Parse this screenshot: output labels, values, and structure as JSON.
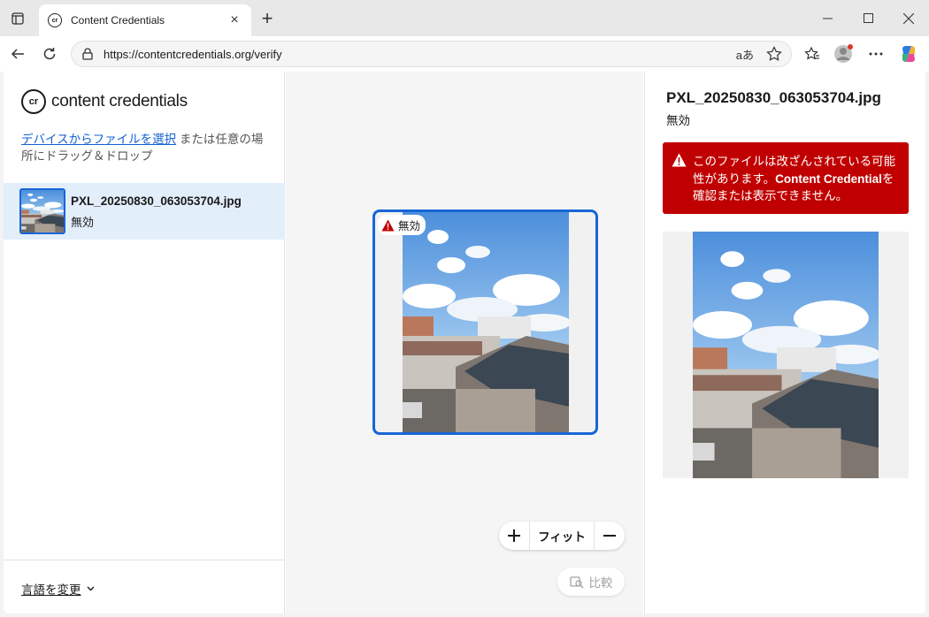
{
  "browser": {
    "tab_title": "Content Credentials",
    "url": "https://contentcredentials.org/verify",
    "translate_label": "aあ"
  },
  "brand": {
    "logo_text": "cr",
    "name": "content credentials"
  },
  "upload": {
    "link_text": "デバイスからファイルを選択",
    "rest_text": " または任意の場所にドラッグ＆ドロップ"
  },
  "files": [
    {
      "name": "PXL_20250830_063053704.jpg",
      "status": "無効"
    }
  ],
  "footer": {
    "language_label": "言語を変更"
  },
  "preview": {
    "badge_label": "無効"
  },
  "zoom": {
    "fit_label": "フィット"
  },
  "compare": {
    "label": "比較"
  },
  "details": {
    "title": "PXL_20250830_063053704.jpg",
    "status": "無効",
    "alert_pre": "このファイルは改ざんされている可能性があります。",
    "alert_cc": "Content Credential",
    "alert_post": "を確認または表示できません。"
  },
  "colors": {
    "accent": "#1766d6",
    "error": "#c00000",
    "selected_bg": "#e3eefb"
  }
}
